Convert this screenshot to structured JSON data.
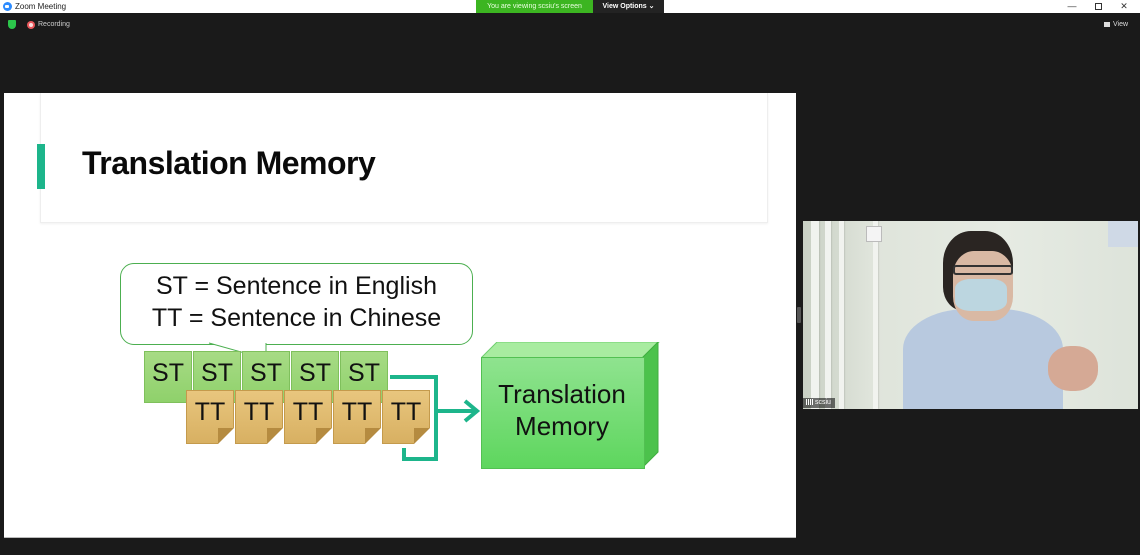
{
  "window": {
    "title": "Zoom Meeting",
    "controls": {
      "minimize": "—",
      "maximize": "",
      "close": "✕"
    }
  },
  "banner": {
    "viewing_text": "You are viewing scsiu's screen",
    "view_options_label": "View Options ⌄"
  },
  "meeting_bar": {
    "recording_label": "Recording",
    "view_label": "View"
  },
  "slide": {
    "title": "Translation Memory",
    "callout_lines": [
      "ST = Sentence in English",
      "TT = Sentence in Chinese"
    ],
    "st_boxes": [
      "ST",
      "ST",
      "ST",
      "ST",
      "ST"
    ],
    "tt_boxes": [
      "TT",
      "TT",
      "TT",
      "TT",
      "TT"
    ],
    "memory_label_lines": [
      "Translation",
      "Memory"
    ],
    "colors": {
      "accent": "#1db58b",
      "st_fill": "#9ad776",
      "tt_fill": "#deb96c",
      "memory_fill": "#6fdc6f",
      "connector": "#1db58b"
    }
  },
  "participant": {
    "name": "scsiu"
  }
}
